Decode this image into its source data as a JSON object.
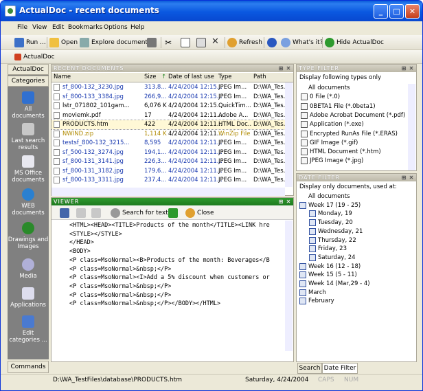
{
  "window": {
    "title": "ActualDoc - recent documents"
  },
  "menu": [
    "File",
    "View",
    "Edit",
    "Bookmarks",
    "Options",
    "Help"
  ],
  "toolbar": {
    "run": "Run ...",
    "open": "Open",
    "explore": "Explore document ...",
    "refresh": "Refresh",
    "whats_it": "What's it?",
    "hide": "Hide ActualDoc"
  },
  "addressbar": {
    "label": "ActualDoc"
  },
  "sidebar": {
    "tab_top": "ActualDoc",
    "tab_categories": "Categories",
    "categories": [
      {
        "label": "All documents",
        "icon": "document-icon"
      },
      {
        "label": "Last search results",
        "icon": "search-icon"
      },
      {
        "label": "MS Office documents",
        "icon": "office-icon"
      },
      {
        "label": "WEB documents",
        "icon": "globe-icon"
      },
      {
        "label": "Drawings and Images",
        "icon": "tree-icon"
      },
      {
        "label": "Media",
        "icon": "media-icon"
      },
      {
        "label": "Applications",
        "icon": "app-icon"
      },
      {
        "label": "Edit categories ...",
        "icon": "edit-icon"
      }
    ],
    "commands": "Commands"
  },
  "recent": {
    "header": "Recent Documents",
    "columns": [
      "Name",
      "Size",
      "Date of last use",
      "Type",
      "Path"
    ],
    "rows": [
      {
        "name": "sf_800-132_3230.jpg",
        "size": "313,8...",
        "date": "4/24/2004 12:15...",
        "type": "JPEG Im...",
        "path": "D:\\WA_Tes...",
        "color": "#1a3ab0"
      },
      {
        "name": "sf_800-133_3384.jpg",
        "size": "266,9...",
        "date": "4/24/2004 12:15...",
        "type": "JPEG Im...",
        "path": "D:\\WA_Tes...",
        "color": "#1a3ab0"
      },
      {
        "name": "lstr_071802_101gam...",
        "size": "6,076 K",
        "date": "4/24/2004 12:15...",
        "type": "QuickTim...",
        "path": "D:\\WA_Tes...",
        "color": "#000000"
      },
      {
        "name": "moviemk.pdf",
        "size": "17",
        "date": "4/24/2004 12:11...",
        "type": "Adobe A...",
        "path": "D:\\WA_Tes...",
        "color": "#000000"
      },
      {
        "name": "PRODUCTS.htm",
        "size": "422",
        "date": "4/24/2004 12:11...",
        "type": "HTML Doc...",
        "path": "D:\\WA_Tes...",
        "color": "#000000"
      },
      {
        "name": "NWIND.zip",
        "size": "1,114 K",
        "date": "4/24/2004 12:11...",
        "type": "WinZip File",
        "path": "D:\\WA_Tes...",
        "color": "#b08a00"
      },
      {
        "name": "testsf_800-132_3215...",
        "size": "8,595",
        "date": "4/24/2004 12:11...",
        "type": "JPEG Im...",
        "path": "D:\\WA_Tes...",
        "color": "#1a3ab0"
      },
      {
        "name": "sf_500-132_3274.jpg",
        "size": "194,1...",
        "date": "4/24/2004 12:11...",
        "type": "JPEG Im...",
        "path": "D:\\WA_Tes...",
        "color": "#1a3ab0"
      },
      {
        "name": "sf_800-131_3141.jpg",
        "size": "226,3...",
        "date": "4/24/2004 12:11...",
        "type": "JPEG Im...",
        "path": "D:\\WA_Tes...",
        "color": "#1a3ab0"
      },
      {
        "name": "sf_800-131_3182.jpg",
        "size": "179,6...",
        "date": "4/24/2004 12:11...",
        "type": "JPEG Im...",
        "path": "D:\\WA_Tes...",
        "color": "#1a3ab0"
      },
      {
        "name": "sf_800-133_3311.jpg",
        "size": "237,4...",
        "date": "4/24/2004 12:11...",
        "type": "JPEG Im...",
        "path": "D:\\WA_Tes...",
        "color": "#1a3ab0"
      }
    ]
  },
  "viewer": {
    "header": "Viewer",
    "search_label": "Search for text ...",
    "close_label": "Close",
    "lines": [
      "<HTML><HEAD><TITLE>Products of the month</TITLE><LINK hre",
      "<STYLE></STYLE>",
      "</HEAD>",
      "<BODY>",
      "<P class=MsoNormal><B>Products of the month: Beverages</B",
      "<P class=MsoNormal>&nbsp;</P>",
      "<P class=MsoNormal><I>Add a 5% discount when customers or",
      "<P class=MsoNormal>&nbsp;</P>",
      "<P class=MsoNormal>&nbsp;</P>",
      "<P class=MsoNormal>&nbsp;</P></BODY></HTML>"
    ]
  },
  "type_filter": {
    "header": "Type Filter",
    "caption": "Display following types only",
    "items": [
      "All documents",
      "0 File (*.0)",
      "0BETA1 File (*.0beta1)",
      "Adobe Acrobat Document (*.pdf)",
      "Application (*.exe)",
      "Encrypted RunAs File (*.ERAS)",
      "GIF Image (*.gif)",
      "HTML Document (*.htm)",
      "JPEG Image (*.jpg)"
    ]
  },
  "date_filter": {
    "header": "Date Filter",
    "caption": "Display only documents, used at:",
    "items": [
      {
        "label": "All documents",
        "indent": 0,
        "icon": false
      },
      {
        "label": "Week 17 (19 - 25)",
        "indent": 0,
        "icon": true
      },
      {
        "label": "Monday, 19",
        "indent": 1,
        "icon": true
      },
      {
        "label": "Tuesday, 20",
        "indent": 1,
        "icon": true
      },
      {
        "label": "Wednesday, 21",
        "indent": 1,
        "icon": true
      },
      {
        "label": "Thursday, 22",
        "indent": 1,
        "icon": true
      },
      {
        "label": "Friday, 23",
        "indent": 1,
        "icon": true
      },
      {
        "label": "Saturday, 24",
        "indent": 1,
        "icon": true
      },
      {
        "label": "Week 16 (12 - 18)",
        "indent": 0,
        "icon": true
      },
      {
        "label": "Week 15 (5 - 11)",
        "indent": 0,
        "icon": true
      },
      {
        "label": "Week 14 (Mar,29 - 4)",
        "indent": 0,
        "icon": true
      },
      {
        "label": "March",
        "indent": 0,
        "icon": true
      },
      {
        "label": "February",
        "indent": 0,
        "icon": true
      }
    ],
    "tab_search": "Search",
    "tab_date": "Date Filter"
  },
  "status": {
    "path": "D:\\WA_TestFiles\\database\\PRODUCTS.htm",
    "date": "Saturday, 4/24/2004",
    "caps": "CAPS",
    "num": "NUM"
  }
}
